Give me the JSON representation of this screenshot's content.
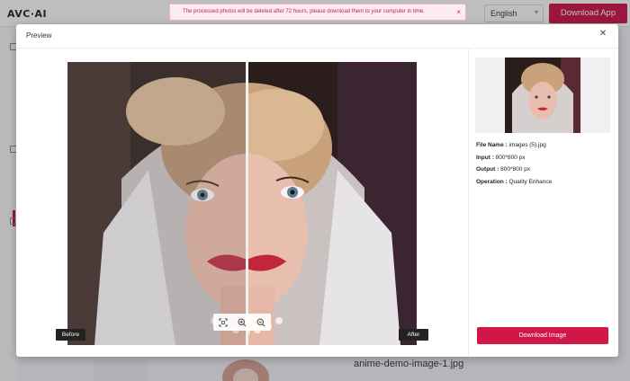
{
  "app": {
    "logo": "AVC·AI",
    "toast_message": "The processed photos will be deleted after 72 hours, please download them to your computer in time.",
    "language": "English",
    "download_app_label": "Download App",
    "background_filename": "anime-demo-image-1.jpg"
  },
  "modal": {
    "title": "Preview",
    "before_label": "Before",
    "after_label": "After",
    "zoom_controls": [
      "fit-screen-icon",
      "zoom-in-icon",
      "zoom-out-icon"
    ],
    "info": {
      "file_name_label": "File Name :",
      "file_name": "images (5).jpg",
      "input_label": "Input :",
      "input": "800*800 px",
      "output_label": "Output :",
      "output": "800*800 px",
      "operation_label": "Operation :",
      "operation": "Quality Enhance"
    },
    "download_label": "Download Image"
  },
  "colors": {
    "accent": "#cf1144",
    "toast_text": "#c01f49"
  }
}
